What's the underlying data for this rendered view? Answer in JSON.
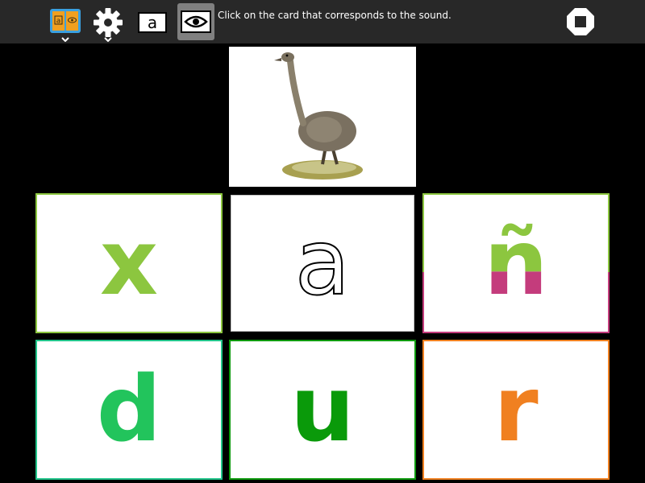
{
  "toolbar": {
    "instruction": "Click on the card that corresponds to the sound.",
    "library_icon_text": "a",
    "letter_button_text": "a",
    "icons": [
      "book-icon",
      "gear-icon",
      "letter-a-icon",
      "eye-icon",
      "stop-icon"
    ]
  },
  "prompt": {
    "image": "ostrich-icon"
  },
  "cards": [
    {
      "letter": "x",
      "color": "#8cc63f"
    },
    {
      "letter": "a",
      "color": "#000000",
      "style": "outline"
    },
    {
      "letter": "ñ",
      "color": "#8cc63f",
      "color_bottom": "#c43c7c"
    },
    {
      "letter": "d",
      "color": "#22c45c"
    },
    {
      "letter": "u",
      "color": "#0a9a0a"
    },
    {
      "letter": "r",
      "color": "#f08020"
    }
  ],
  "colors": {
    "toolbar_bg": "#282828",
    "page_bg": "#000000",
    "active_button": "#808080",
    "book_accent": "#f0a020",
    "book_blue": "#3aa0e0"
  }
}
